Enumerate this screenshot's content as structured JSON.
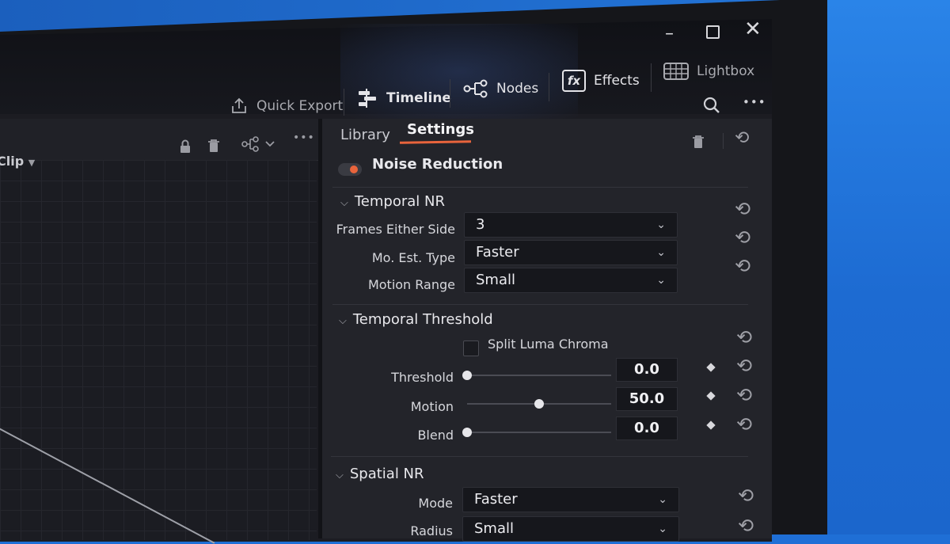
{
  "window_controls": {
    "minimize": "–",
    "close": "✕"
  },
  "toolbar": {
    "quick_export": "Quick Export",
    "timeline": "Timeline",
    "nodes": "Nodes",
    "effects": "Effects",
    "effects_icon_text": "fx",
    "lightbox": "Lightbox",
    "more": "•••"
  },
  "left_panel": {
    "clip_label": "Clip",
    "more": "•••"
  },
  "tabs": {
    "library": "Library",
    "settings": "Settings",
    "active": "Settings"
  },
  "effect": {
    "name": "Noise Reduction",
    "enabled": true,
    "accent_color": "#e8643c"
  },
  "temporal_nr": {
    "title": "Temporal NR",
    "fields": [
      {
        "label": "Frames Either Side",
        "value": "3"
      },
      {
        "label": "Mo. Est. Type",
        "value": "Faster"
      },
      {
        "label": "Motion Range",
        "value": "Small"
      }
    ]
  },
  "temporal_threshold": {
    "title": "Temporal Threshold",
    "split_luma_chroma": {
      "label": "Split Luma Chroma",
      "checked": false
    },
    "sliders": [
      {
        "label": "Threshold",
        "value": "0.0",
        "fraction": 0.0
      },
      {
        "label": "Motion",
        "value": "50.0",
        "fraction": 0.5
      },
      {
        "label": "Blend",
        "value": "0.0",
        "fraction": 0.0
      }
    ]
  },
  "spatial_nr": {
    "title": "Spatial NR",
    "fields": [
      {
        "label": "Mode",
        "value": "Faster"
      },
      {
        "label": "Radius",
        "value": "Small"
      }
    ]
  },
  "icons": {
    "reset": "⟲",
    "chevron_down": "⌵",
    "search": "⌕"
  }
}
